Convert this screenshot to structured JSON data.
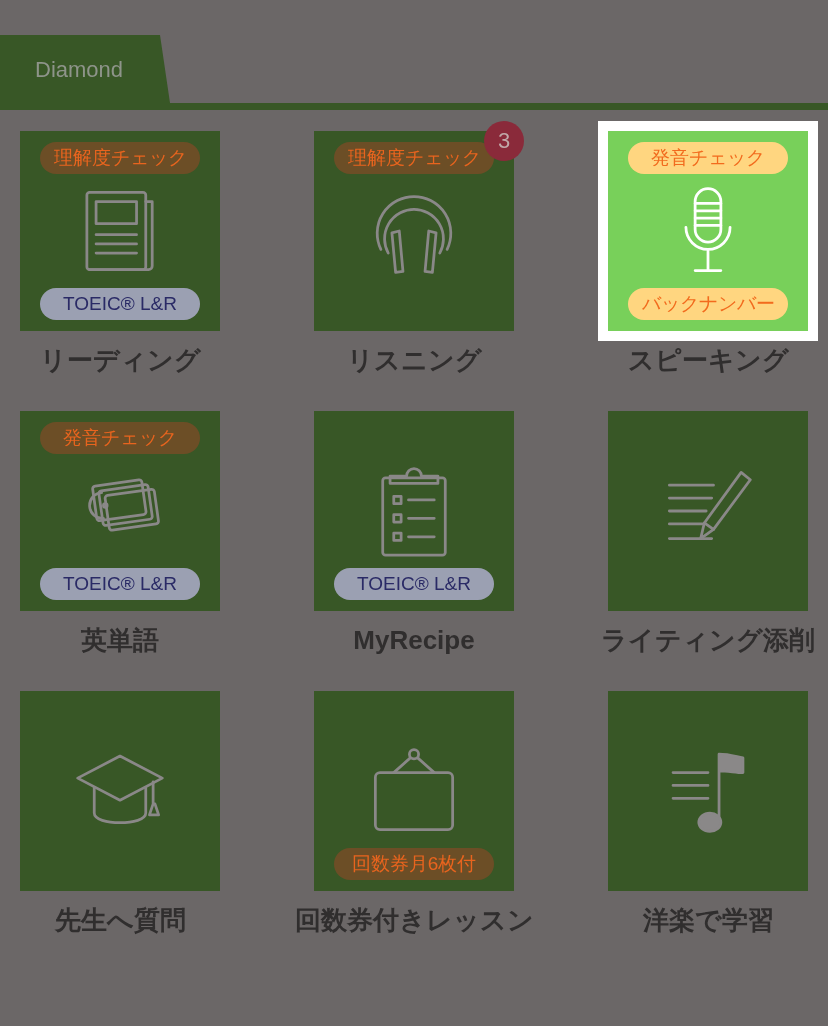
{
  "tabs": [
    {
      "label": "Diamond",
      "selected": true
    }
  ],
  "tiles": [
    {
      "label": "リーディング",
      "kind": "newspaper",
      "highlighted": false,
      "top_badge": {
        "text": "理解度チェック",
        "kind": "orange"
      },
      "bottom_badge": {
        "text": "TOEIC® L&R",
        "kind": "blue"
      }
    },
    {
      "label": "リスニング",
      "kind": "headphones",
      "highlighted": false,
      "top_badge": {
        "text": "理解度チェック",
        "kind": "orange"
      },
      "count": "3"
    },
    {
      "label": "スピーキング",
      "kind": "microphone",
      "highlighted": true,
      "top_badge": {
        "text": "発音チェック",
        "kind": "orange"
      },
      "bottom_badge": {
        "text": "バックナンバー",
        "kind": "orange"
      }
    },
    {
      "label": "英単語",
      "kind": "tags",
      "highlighted": false,
      "top_badge": {
        "text": "発音チェック",
        "kind": "orange"
      },
      "bottom_badge": {
        "text": "TOEIC® L&R",
        "kind": "blue"
      }
    },
    {
      "label": "MyRecipe",
      "kind": "clipboard",
      "highlighted": false,
      "bottom_badge": {
        "text": "TOEIC® L&R",
        "kind": "blue"
      }
    },
    {
      "label": "ライティング添削",
      "kind": "writing",
      "highlighted": false
    },
    {
      "label": "先生へ質問",
      "kind": "graduation",
      "highlighted": false
    },
    {
      "label": "回数券付きレッスン",
      "kind": "sign",
      "highlighted": false,
      "bottom_badge": {
        "text": "回数券月6枚付",
        "kind": "orange"
      }
    },
    {
      "label": "洋楽で学習",
      "kind": "music",
      "highlighted": false
    }
  ]
}
